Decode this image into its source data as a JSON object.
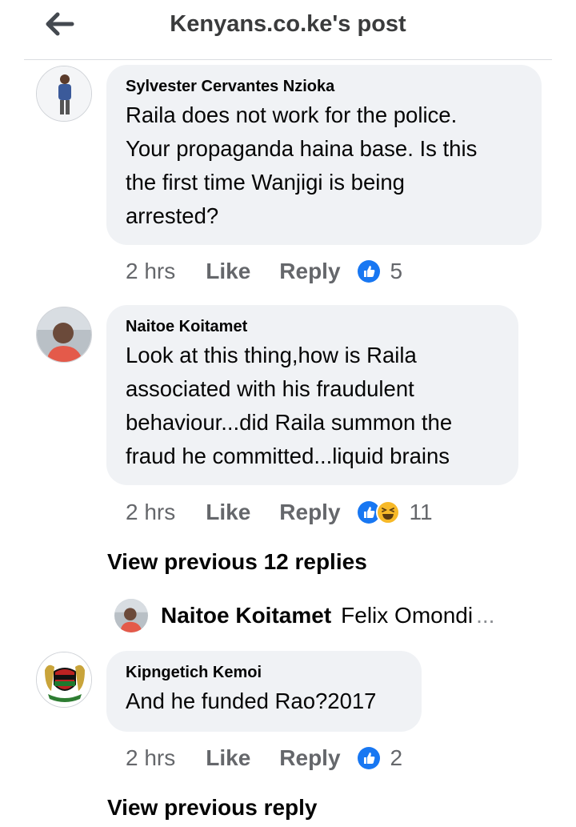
{
  "header": {
    "title": "Kenyans.co.ke's post",
    "back_icon": "arrow-left-icon"
  },
  "comments": [
    {
      "author": "Sylvester Cervantes Nzioka",
      "lines": [
        "Raila does not work for the police.",
        "Your propaganda haina base. Is this",
        "the first time Wanjigi is being",
        "arrested?"
      ],
      "time": "2 hrs",
      "like": "Like",
      "reply": "Reply",
      "reactions": [
        "like-icon"
      ],
      "reaction_count": "5"
    },
    {
      "author": "Naitoe Koitamet",
      "lines": [
        "Look at this thing,how is Raila",
        "associated with his fraudulent",
        "behaviour...did Raila summon the",
        "fraud he committed...liquid brains"
      ],
      "time": "2 hrs",
      "like": "Like",
      "reply": "Reply",
      "reactions": [
        "like-icon",
        "haha-icon"
      ],
      "reaction_count": "11"
    },
    {
      "author": "Kipngetich Kemoi",
      "lines": [
        "And he funded Rao?2017"
      ],
      "time": "2 hrs",
      "like": "Like",
      "reply": "Reply",
      "reactions": [
        "like-icon"
      ],
      "reaction_count": "2"
    }
  ],
  "view_previous_replies": "View previous 12 replies",
  "reply_preview": {
    "author": "Naitoe Koitamet",
    "text": "Felix Omondi",
    "ellipsis": "..."
  },
  "view_previous_reply": "View previous reply",
  "colors": {
    "bubble": "#f0f2f5",
    "meta_text": "#65676b",
    "like_blue": "#1877f2",
    "haha_yellow": "#f7b928"
  }
}
